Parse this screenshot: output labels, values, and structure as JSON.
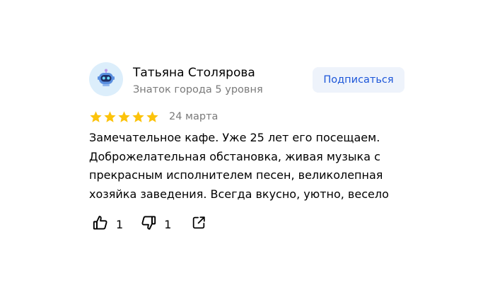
{
  "review": {
    "author": {
      "name": "Татьяна Столярова",
      "level": "Знаток города 5 уровня",
      "avatar_icon": "robot-avatar-icon"
    },
    "subscribe_label": "Подписаться",
    "rating": 5,
    "rating_max": 5,
    "date": "24 марта",
    "text": "Замечательное кафе. Уже 25 лет его посещаем. Доброжелательная обстановка, живая музыка с прекрасным исполнителем песен, великолепная хозяйка заведения. Всегда вкусно, уютно, весело",
    "likes": "1",
    "dislikes": "1"
  },
  "icons": {
    "like": "thumbs-up-icon",
    "dislike": "thumbs-down-icon",
    "share": "share-icon",
    "star": "star-icon"
  },
  "colors": {
    "star": "#fcc30b",
    "subscribe_bg": "#eef3fb",
    "subscribe_text": "#1c56d9",
    "secondary_text": "#7a7a7a",
    "avatar_bg": "#dceefb"
  }
}
